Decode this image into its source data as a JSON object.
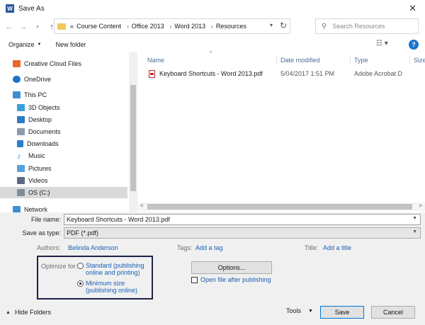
{
  "window": {
    "title": "Save As",
    "app_icon": "word-icon"
  },
  "nav": {
    "breadcrumb": [
      "Course Content",
      "Office 2013",
      "Word 2013",
      "Resources"
    ],
    "overflow": "«",
    "search_placeholder": "Search Resources"
  },
  "toolbar": {
    "organize": "Organize",
    "new_folder": "New folder"
  },
  "sidebar": {
    "items": [
      {
        "label": "Creative Cloud Files",
        "icon": "creative-cloud-icon",
        "color": "#e8692a"
      },
      {
        "label": "OneDrive",
        "icon": "onedrive-icon",
        "color": "#1a73c8"
      },
      {
        "label": "This PC",
        "icon": "computer-icon",
        "color": "#3d8fd1"
      },
      {
        "label": "3D Objects",
        "icon": "3d-objects-icon",
        "color": "#3aa0d8"
      },
      {
        "label": "Desktop",
        "icon": "desktop-icon",
        "color": "#2c7cc4"
      },
      {
        "label": "Documents",
        "icon": "documents-icon",
        "color": "#8a9bb0"
      },
      {
        "label": "Downloads",
        "icon": "downloads-icon",
        "color": "#2b7fd1"
      },
      {
        "label": "Music",
        "icon": "music-icon",
        "color": "#2b7fd1"
      },
      {
        "label": "Pictures",
        "icon": "pictures-icon",
        "color": "#5aa1d8"
      },
      {
        "label": "Videos",
        "icon": "videos-icon",
        "color": "#5a6a80"
      },
      {
        "label": "OS (C:)",
        "icon": "drive-icon",
        "color": "#7f8c99"
      },
      {
        "label": "Network",
        "icon": "network-icon",
        "color": "#3d8fd1"
      }
    ]
  },
  "files": {
    "columns": [
      "Name",
      "Date modified",
      "Type",
      "Size"
    ],
    "rows": [
      {
        "name": "Keyboard Shortcuts - Word 2013.pdf",
        "date": "5/04/2017 1:51 PM",
        "type": "Adobe Acrobat D",
        "icon": "pdf-icon"
      }
    ]
  },
  "form": {
    "file_name_label": "File name:",
    "file_name_value": "Keyboard Shortcuts - Word 2013.pdf",
    "save_type_label": "Save as type:",
    "save_type_value": "PDF (*.pdf)",
    "authors_label": "Authors:",
    "authors_value": "Belinda Anderson",
    "tags_label": "Tags:",
    "tags_value": "Add a tag",
    "title_label": "Title:",
    "title_value": "Add a title"
  },
  "optimize": {
    "label": "Optimize for:",
    "option1": "Standard (publishing online and printing)",
    "option2": "Minimum size (publishing online)",
    "selected": "Minimum size (publishing online)"
  },
  "options_button": "Options...",
  "open_after": "Open file after publishing",
  "footer": {
    "hide_folders": "Hide Folders",
    "tools": "Tools",
    "save": "Save",
    "cancel": "Cancel"
  }
}
